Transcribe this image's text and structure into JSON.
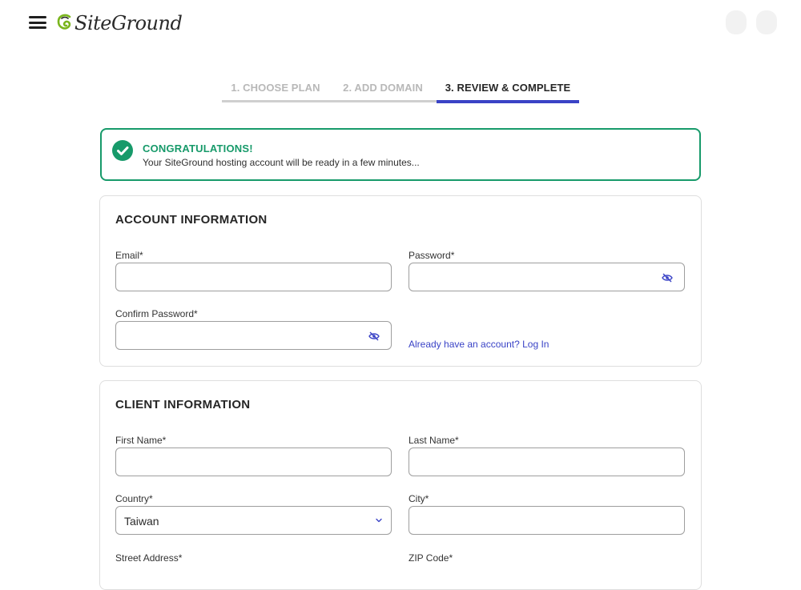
{
  "header": {
    "logo_text": "SiteGround",
    "menu_icon": "hamburger-menu-icon"
  },
  "steps": [
    {
      "label": "1. CHOOSE PLAN",
      "active": false
    },
    {
      "label": "2. ADD DOMAIN",
      "active": false
    },
    {
      "label": "3. REVIEW & COMPLETE",
      "active": true
    }
  ],
  "banner": {
    "title": "CONGRATULATIONS!",
    "message": "Your SiteGround hosting account will be ready in a few minutes...",
    "icon": "checkmark-circle-icon"
  },
  "account": {
    "title": "ACCOUNT INFORMATION",
    "email_label": "Email*",
    "email_value": "",
    "password_label": "Password*",
    "password_value": "",
    "confirm_label": "Confirm Password*",
    "confirm_value": "",
    "login_link": "Already have an account? Log In"
  },
  "client": {
    "title": "CLIENT INFORMATION",
    "first_name_label": "First Name*",
    "first_name_value": "",
    "last_name_label": "Last Name*",
    "last_name_value": "",
    "country_label": "Country*",
    "country_value": "Taiwan",
    "city_label": "City*",
    "city_value": "",
    "street_label": "Street Address*",
    "zip_label": "ZIP Code*"
  },
  "colors": {
    "accent": "#3a43c6",
    "success": "#179a6a",
    "brand_green": "#7ab51d"
  }
}
